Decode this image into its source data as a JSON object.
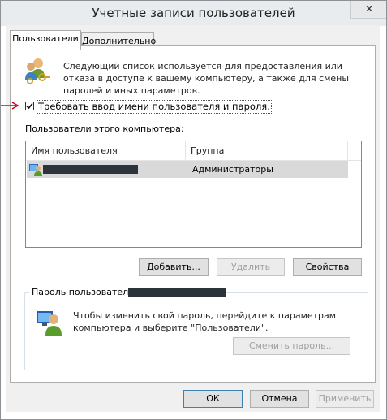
{
  "window": {
    "title": "Учетные записи пользователей",
    "close_glyph": "✕"
  },
  "tabs": [
    {
      "label": "Пользователи",
      "active": true
    },
    {
      "label": "Дополнительно",
      "active": false
    }
  ],
  "intro": {
    "text": "Следующий список используется для предоставления или отказа в доступе к вашему компьютеру, а также для смены паролей и иных параметров.",
    "icon": "users-keys-icon"
  },
  "require_login": {
    "label": "Требовать ввод имени пользователя и пароля.",
    "checked": true,
    "check_glyph": "✔"
  },
  "annotation": {
    "arrow_color": "#d0021b"
  },
  "users_list": {
    "caption": "Пользователи этого компьютера:",
    "columns": [
      "Имя пользователя",
      "Группа"
    ],
    "rows": [
      {
        "user": "",
        "group": "Администраторы",
        "selected": true
      }
    ]
  },
  "user_buttons": {
    "add": "Добавить...",
    "remove": "Удалить",
    "properties": "Свойства"
  },
  "password_group": {
    "title": "Пароль пользователя",
    "text": "Чтобы изменить свой пароль, перейдите к параметрам компьютера и выберите \"Пользователи\".",
    "change_button": "Сменить пароль...",
    "icon": "user-monitor-icon"
  },
  "dialog_buttons": {
    "ok": "ОК",
    "cancel": "Отмена",
    "apply": "Применить"
  },
  "colors": {
    "redaction": "#2d333a",
    "selection": "#d9d9d9",
    "panel_bg": "#f0f0f0"
  }
}
